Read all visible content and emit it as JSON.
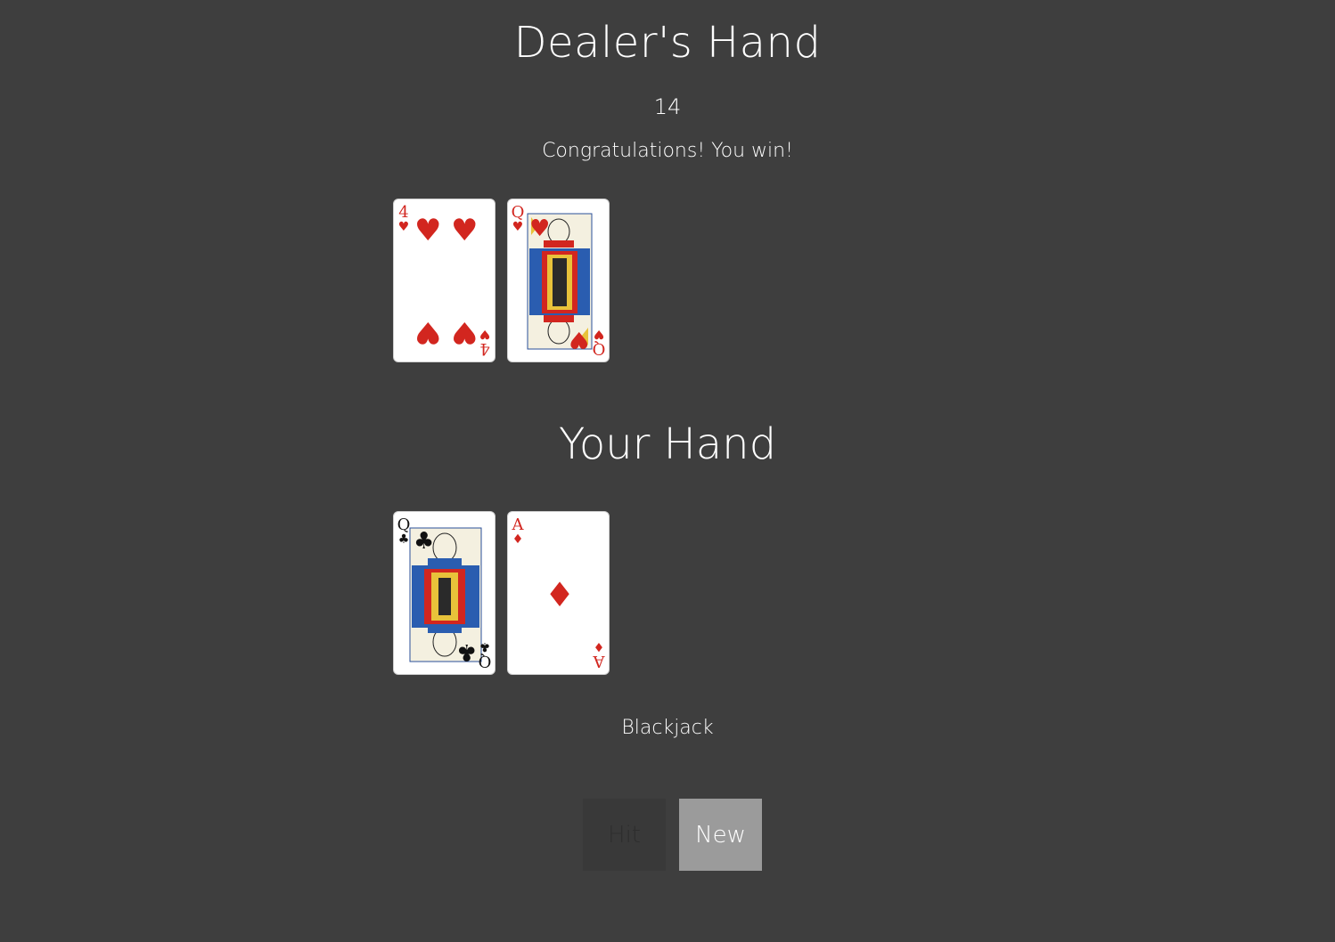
{
  "dealer": {
    "title": "Dealer's Hand",
    "score": "14",
    "result": "Congratulations! You win!",
    "cards": [
      {
        "rank": "4",
        "suit": "♥",
        "suit_name": "hearts",
        "color": "#d2261f"
      },
      {
        "rank": "Q",
        "suit": "♥",
        "suit_name": "hearts",
        "color": "#d2261f"
      }
    ]
  },
  "player": {
    "title": "Your Hand",
    "status": "Blackjack",
    "cards": [
      {
        "rank": "Q",
        "suit": "♣",
        "suit_name": "clubs",
        "color": "#111111"
      },
      {
        "rank": "A",
        "suit": "♦",
        "suit_name": "diamonds",
        "color": "#d2261f"
      }
    ]
  },
  "buttons": {
    "hit_label": "Hit",
    "new_label": "New"
  },
  "colors": {
    "background": "#3e3e3e",
    "hit_disabled_bg": "#393939",
    "new_bg": "#9b9b9b",
    "red_suit": "#d2261f"
  }
}
